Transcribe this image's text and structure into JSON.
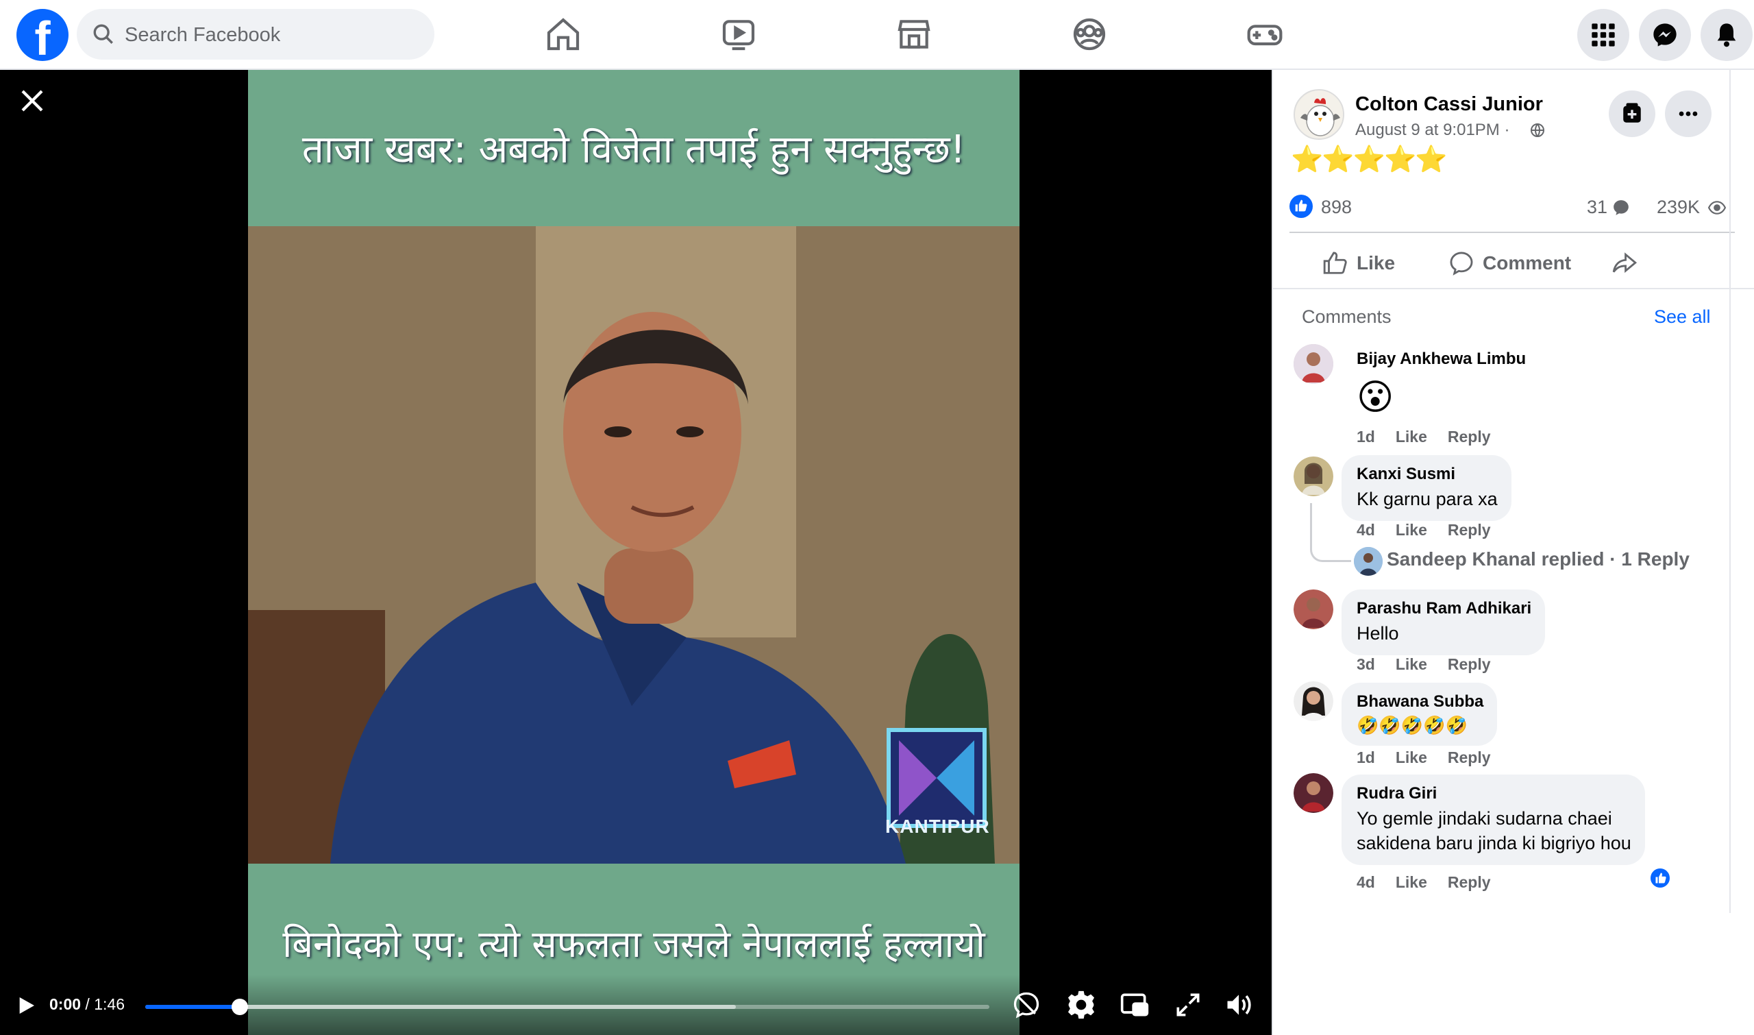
{
  "topbar": {
    "logo": "f",
    "search_placeholder": "Search Facebook",
    "nav_icons": [
      "home-icon",
      "video-icon",
      "marketplace-icon",
      "groups-icon",
      "gaming-icon"
    ],
    "right_icons": [
      "menu-grid-icon",
      "messenger-icon",
      "notifications-icon"
    ]
  },
  "video": {
    "caption_top": "ताजा खबर: अबको विजेता तपाई हुन सक्नुहुन्छ!",
    "caption_bottom": "बिनोदको एप: त्यो सफलता जसले नेपाललाई हल्लायो",
    "watermark": "KANTIPUR",
    "current_time": "0:00",
    "separator": " / ",
    "duration": "1:46",
    "progress_played": 0.112,
    "progress_buffered": 0.7,
    "accent": "#0866ff"
  },
  "post": {
    "author": "Colton Cassi Junior",
    "date": "August 9 at 9:01PM · ",
    "stars": "⭐⭐⭐⭐⭐",
    "likes": "898",
    "comments_count": "31",
    "views": "239K",
    "actions": {
      "like": "Like",
      "comment": "Comment"
    }
  },
  "comments": {
    "heading": "Comments",
    "see_all": "See all",
    "meta_like": "Like",
    "meta_reply": "Reply",
    "items": [
      {
        "name": "Bijay Ankhewa Limbu",
        "text": "😮",
        "age": "1d"
      },
      {
        "name": "Kanxi Susmi",
        "text": "Kk garnu para xa",
        "age": "4d"
      },
      {
        "name": "Parashu Ram Adhikari",
        "text": "Hello",
        "age": "3d"
      },
      {
        "name": "Bhawana Subba",
        "text": "🤣🤣🤣🤣🤣",
        "age": "1d"
      },
      {
        "name": "Rudra Giri",
        "text_line1": "Yo gemle jindaki sudarna chaei",
        "text_line2": "sakidena baru jinda ki bigriyo hou",
        "age": "4d"
      }
    ],
    "replied_text": "Sandeep Khanal replied · 1 Reply"
  }
}
